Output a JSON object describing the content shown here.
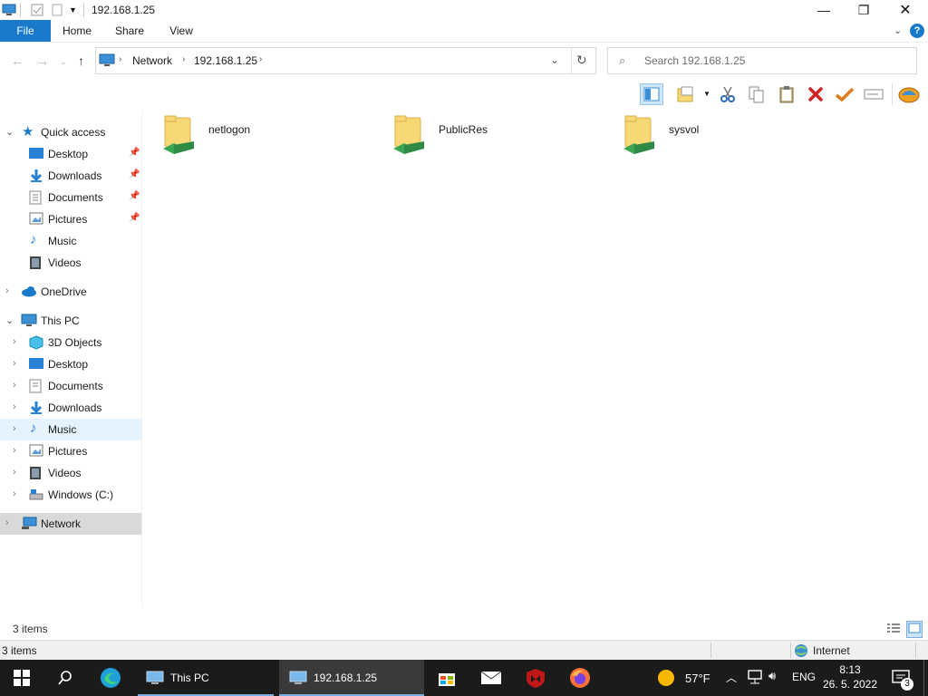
{
  "window": {
    "title": "192.168.1.25"
  },
  "ribbon": {
    "tabs": [
      "File",
      "Home",
      "Share",
      "View"
    ]
  },
  "address": {
    "crumbs": [
      "Network",
      "192.168.1.25"
    ]
  },
  "search": {
    "placeholder": "Search 192.168.1.25"
  },
  "nav": {
    "quick_access": "Quick access",
    "qa_items": [
      "Desktop",
      "Downloads",
      "Documents",
      "Pictures",
      "Music",
      "Videos"
    ],
    "onedrive": "OneDrive",
    "this_pc": "This PC",
    "pc_items": [
      "3D Objects",
      "Desktop",
      "Documents",
      "Downloads",
      "Music",
      "Pictures",
      "Videos",
      "Windows (C:)"
    ],
    "network": "Network"
  },
  "content": {
    "folders": [
      "netlogon",
      "PublicRes",
      "sysvol"
    ]
  },
  "status": {
    "items": "3 items",
    "items_bottom": "3 items",
    "zone": "Internet"
  },
  "taskbar": {
    "apps": [
      "This PC",
      "192.168.1.25"
    ],
    "weather": "57°F",
    "lang": "ENG",
    "time": "8:13",
    "date": "26. 5. 2022",
    "notif_count": "3"
  },
  "colors": {
    "accent": "#1979ca",
    "folder": "#f8d775",
    "share": "#3aa655",
    "taskbar": "#1b1b1b"
  }
}
